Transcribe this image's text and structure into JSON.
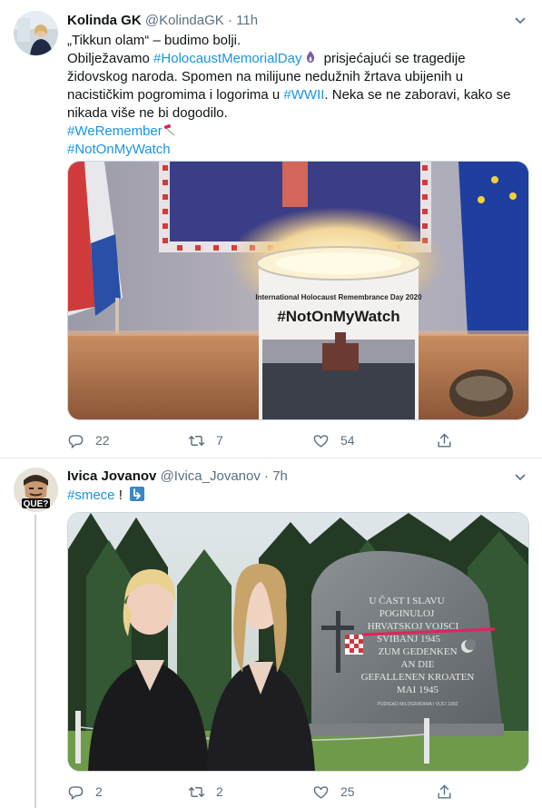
{
  "tweet1": {
    "name": "Kolinda GK",
    "handle": "@KolindaGK",
    "separator": "·",
    "time": "11h",
    "line1": "„Tikkun olam“ – budimo bolji.",
    "line2_pre": "Obilježavamo ",
    "hashtag_memorial": "#HolocaustMemorialDay",
    "line2_post": " prisjećajući se tragedije židovskog naroda. Spomen na milijune nedužnih žrtava ubijenih u nacističkim pogromima i logorima u ",
    "hashtag_wwii": "#WWII",
    "line2_end": ". Neka se ne zaboravi, kako se nikada više ne bi dogodilo.",
    "hashtag_weremember": "#WeRemember",
    "hashtag_notonmywatch": "#NotOnMyWatch",
    "media_candle_label": "International Holocaust Remembrance Day 2020",
    "media_candle_hashtag": "#NotOnMyWatch",
    "replies": "22",
    "retweets": "7",
    "likes": "54"
  },
  "tweet2": {
    "name": "Ivica Jovanov",
    "handle": "@Ivica_Jovanov",
    "separator": "·",
    "time": "7h",
    "hashtag": "#smece",
    "exclamation": " !",
    "avatar_text": "QUE?",
    "stone_lines": [
      "U ČAST I SLAVU",
      "POGINULOJ",
      "HRVATSKOJ VOJSCI",
      "SVIBANJ 1945",
      "ZUM GEDENKEN",
      "AN DIE",
      "GEFALLENEN KROATEN",
      "MAI 1945"
    ],
    "stone_footer": "PODIGAO MILOGRADIMA I VIJCI 1992",
    "replies": "2",
    "retweets": "2",
    "likes": "25"
  },
  "colors": {
    "link": "#1b95e0",
    "meta": "#5b7083",
    "divider": "#e6ecf0"
  }
}
